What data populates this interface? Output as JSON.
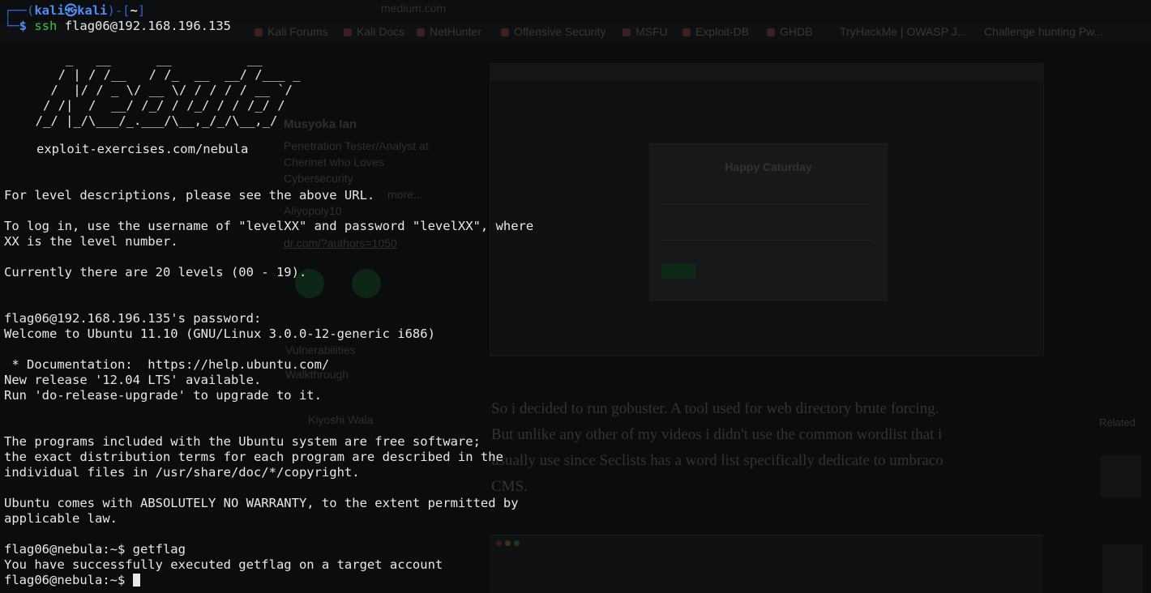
{
  "background": {
    "bookmarks": [
      "Kali Forums",
      "Kali Docs",
      "NetHunter",
      "Offensive Security",
      "MSFU",
      "Exploit-DB",
      "GHDB",
      "TryHackMe | OWASP J...",
      "Challenge hunting  Pw..."
    ],
    "url_fragment": "medium.com",
    "author_name": "Musyoka Ian",
    "author_bio": [
      "Penetration Tester/Analyst at",
      "Cherinet who Loves",
      "Cybersecurity",
      "more...",
      "Aliyopoly10",
      "dr.com/?authors=1050"
    ],
    "dialog_title": "Happy Caturday",
    "article_lines": [
      "So i decided to run gobuster. A tool used for web directory brute forcing.",
      "But unlike any other of my videos i didn't use the common wordlist that i",
      "usually use since Seclists has a word list specifically dedicate to umbraco",
      "CMS."
    ],
    "related_label": "Related",
    "sidebar_items": [
      "Vulnerabilities",
      "Walkthrough",
      "Kiyoshi Wala"
    ]
  },
  "terminal": {
    "prompt": {
      "frame_top": "┌──(",
      "user": "kali㉿kali",
      "frame_mid": ")-[",
      "dir": "~",
      "frame_end": "]",
      "frame_bottom": "└─",
      "dollar": "$",
      "command": "ssh",
      "argument": "flag06@192.168.196.135"
    },
    "banner_ascii": "      _   __      __          __\n     / | / /__   / /_  __  __/ /___ _\n    /  |/ / _ \\/ __ \\/ / / / / __ `/\n   / /|  /  __/ /_/ / /_/ / / /_/ /\n  /_/ |_/\\___/_.___/\\__,_/_/\\__,_/",
    "banner_url": "exploit-exercises.com/nebula",
    "lines_block1": "For level descriptions, please see the above URL.\n\nTo log in, use the username of \"levelXX\" and password \"levelXX\", where\nXX is the level number.\n\nCurrently there are 20 levels (00 - 19).",
    "lines_block2": "flag06@192.168.196.135's password:\nWelcome to Ubuntu 11.10 (GNU/Linux 3.0.0-12-generic i686)\n\n * Documentation:  https://help.ubuntu.com/\nNew release '12.04 LTS' available.\nRun 'do-release-upgrade' to upgrade to it.",
    "lines_block3": "The programs included with the Ubuntu system are free software;\nthe exact distribution terms for each program are described in the\nindividual files in /usr/share/doc/*/copyright.\n\nUbuntu comes with ABSOLUTELY NO WARRANTY, to the extent permitted by\napplicable law.",
    "lines_block4": "flag06@nebula:~$ getflag\nYou have successfully executed getflag on a target account",
    "final_prompt": "flag06@nebula:~$ "
  }
}
